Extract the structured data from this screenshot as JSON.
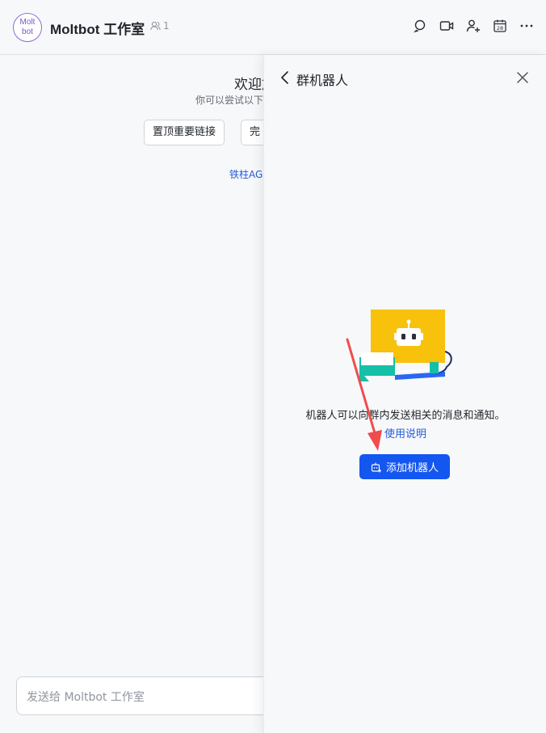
{
  "header": {
    "avatar_line1": "Molt",
    "avatar_line2": "bot",
    "title": "Moltbot 工作室",
    "member_count": "1",
    "actions": [
      "search-icon",
      "video-icon",
      "add-member-icon",
      "calendar-icon",
      "more-icon"
    ],
    "calendar_day": "28"
  },
  "main": {
    "welcome_title": "欢迎加",
    "welcome_sub": "你可以尝试以下",
    "quick_buttons": [
      "置顶重要链接",
      "完"
    ],
    "quick_link": "铁柱AGI",
    "composer_placeholder": "发送给 Moltbot 工作室"
  },
  "panel": {
    "title": "群机器人",
    "description": "机器人可以向群内发送相关的消息和通知。",
    "link": "使用说明",
    "add_button": "添加机器人"
  },
  "colors": {
    "accent": "#1456f0",
    "link": "#245bdb",
    "avatar": "#7a55c9",
    "annotation_arrow": "#f04c4c",
    "bot_yellow": "#f8c10c",
    "bot_teal": "#14c0a8"
  }
}
